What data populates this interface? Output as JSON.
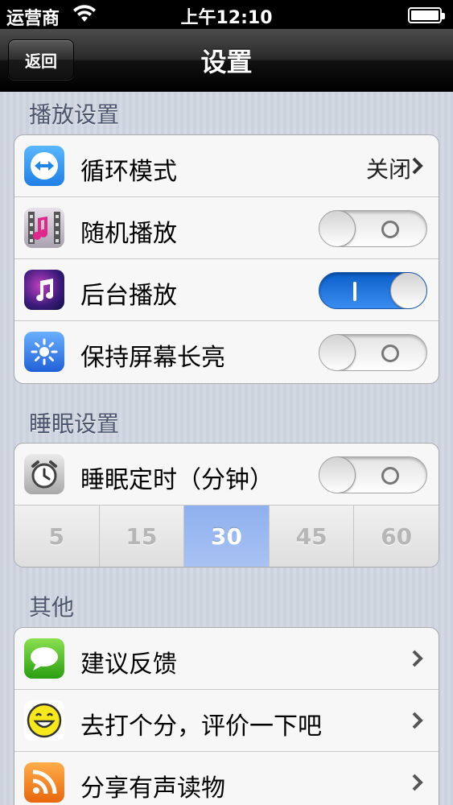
{
  "status": {
    "carrier": "运营商",
    "time": "上午12:10"
  },
  "nav": {
    "back_label": "返回",
    "title": "设置"
  },
  "sections": {
    "playback_header": "播放设置",
    "sleep_header": "睡眠设置",
    "other_header": "其他"
  },
  "playback": {
    "loop_mode": {
      "label": "循环模式",
      "value": "关闭"
    },
    "shuffle": {
      "label": "随机播放",
      "on": false
    },
    "background": {
      "label": "后台播放",
      "on": true
    },
    "screen_on": {
      "label": "保持屏幕长亮",
      "on": false
    }
  },
  "sleep": {
    "timer": {
      "label": "睡眠定时（分钟）",
      "on": false
    },
    "options": [
      "5",
      "15",
      "30",
      "45",
      "60"
    ],
    "selected": "30"
  },
  "other": {
    "feedback": "建议反馈",
    "rate": "去打个分，评价一下吧",
    "share": "分享有声读物"
  },
  "colors": {
    "toggle_on": "#2a78e4",
    "selected_segment": "#9ab8f1",
    "section_header": "#4c566c"
  }
}
